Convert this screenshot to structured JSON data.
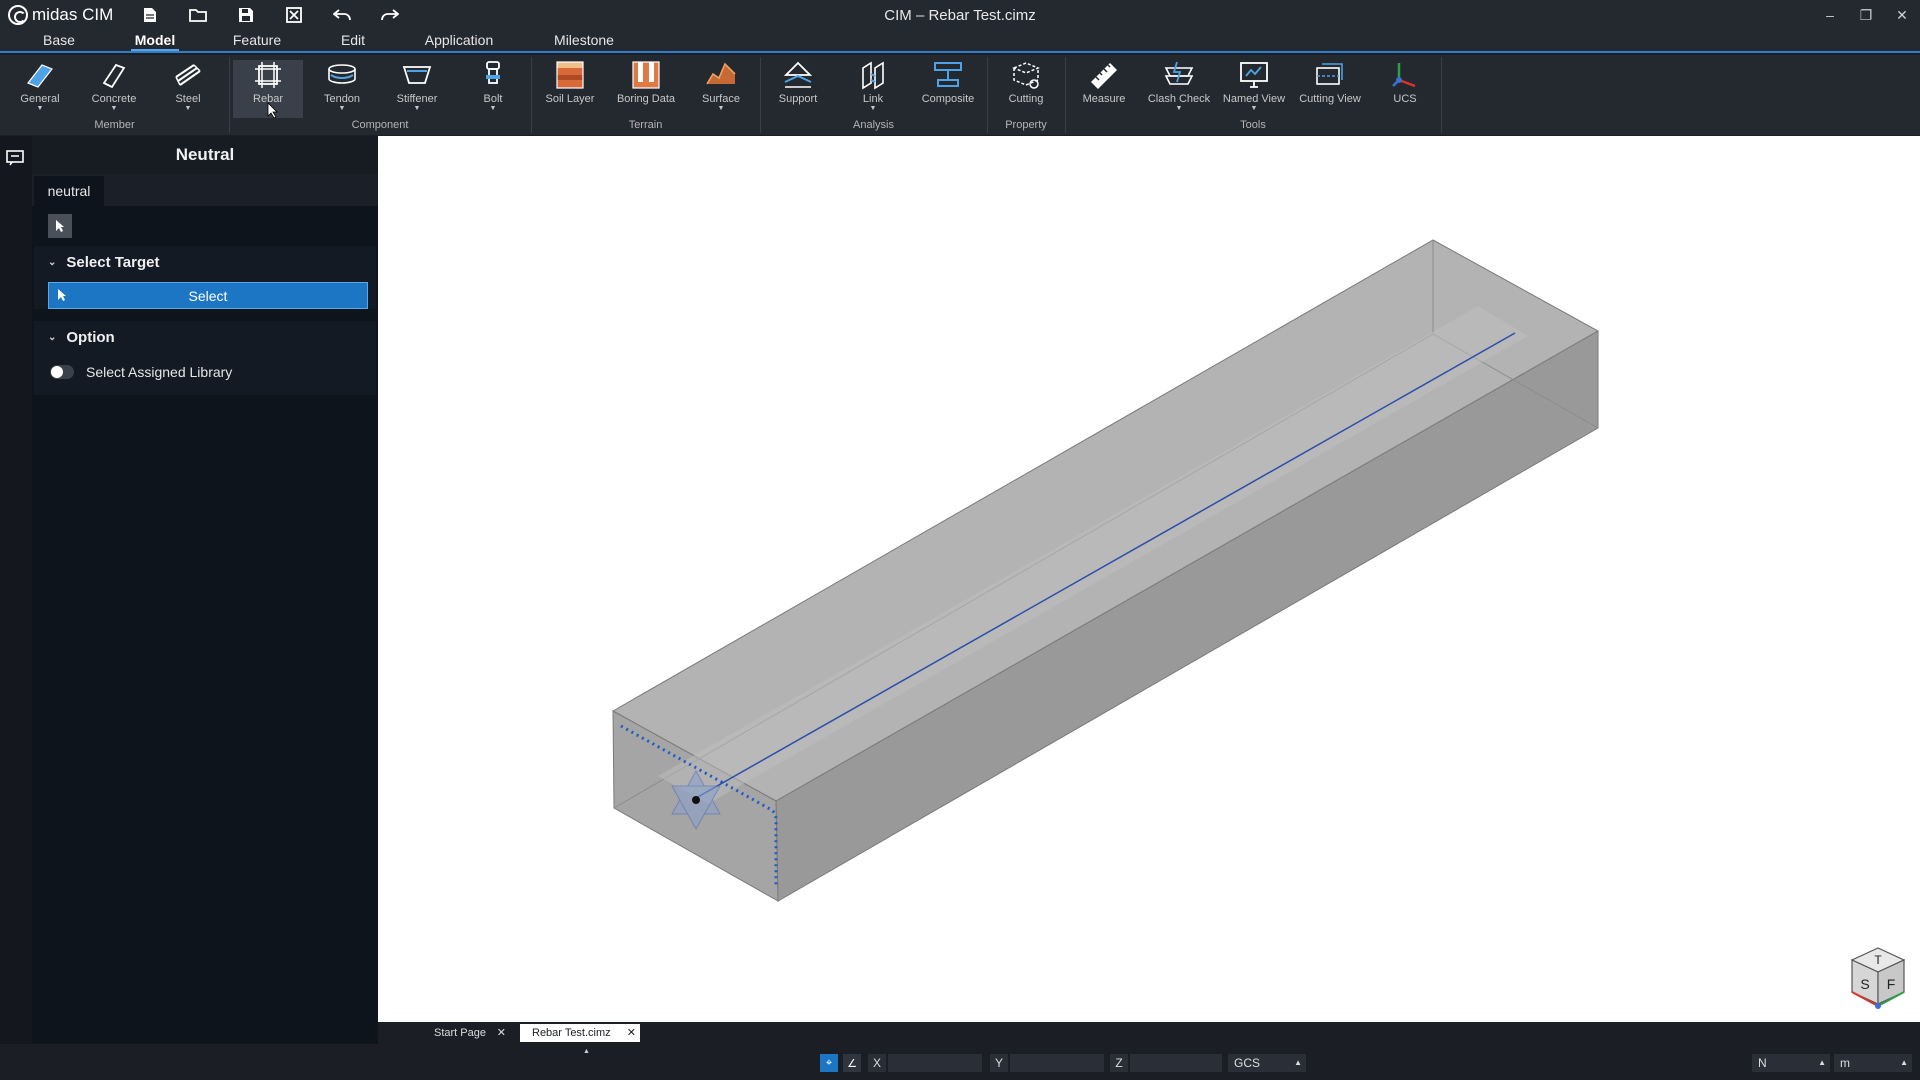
{
  "app": {
    "logo_text": "midas CIM",
    "window_title": "CIM – Rebar Test.cimz"
  },
  "quick_access": [
    "new-file-icon",
    "open-folder-icon",
    "save-icon",
    "close-file-icon",
    "undo-icon",
    "redo-icon"
  ],
  "window_controls": {
    "minimize": "–",
    "restore": "❐",
    "close": "✕"
  },
  "menu": {
    "tabs": [
      {
        "label": "Base"
      },
      {
        "label": "Model",
        "active": true
      },
      {
        "label": "Feature"
      },
      {
        "label": "Edit"
      },
      {
        "label": "Application"
      },
      {
        "label": "Milestone"
      }
    ]
  },
  "ribbon": {
    "buttons": [
      {
        "label": "General",
        "icon": "general-icon",
        "dropdown": true
      },
      {
        "label": "Concrete",
        "icon": "concrete-icon",
        "dropdown": true
      },
      {
        "label": "Steel",
        "icon": "steel-icon",
        "dropdown": true
      },
      {
        "label": "Rebar",
        "icon": "rebar-icon",
        "dropdown": false,
        "hover": true
      },
      {
        "label": "Tendon",
        "icon": "tendon-icon",
        "dropdown": true
      },
      {
        "label": "Stiffener",
        "icon": "stiffener-icon",
        "dropdown": true
      },
      {
        "label": "Bolt",
        "icon": "bolt-icon",
        "dropdown": true
      },
      {
        "label": "Soil Layer",
        "icon": "soil-layer-icon",
        "dropdown": false
      },
      {
        "label": "Boring Data",
        "icon": "boring-data-icon",
        "dropdown": false
      },
      {
        "label": "Surface",
        "icon": "surface-icon",
        "dropdown": true
      },
      {
        "label": "Support",
        "icon": "support-icon",
        "dropdown": false
      },
      {
        "label": "Link",
        "icon": "link-icon",
        "dropdown": true
      },
      {
        "label": "Composite",
        "icon": "composite-icon",
        "dropdown": false
      },
      {
        "label": "Cutting",
        "icon": "cutting-icon",
        "dropdown": false
      },
      {
        "label": "Measure",
        "icon": "measure-icon",
        "dropdown": false
      },
      {
        "label": "Clash Check",
        "icon": "clash-check-icon",
        "dropdown": true
      },
      {
        "label": "Named View",
        "icon": "named-view-icon",
        "dropdown": true
      },
      {
        "label": "Cutting View",
        "icon": "cutting-view-icon",
        "dropdown": false
      },
      {
        "label": "UCS",
        "icon": "ucs-icon",
        "dropdown": false
      }
    ],
    "groups": [
      {
        "label": "Member"
      },
      {
        "label": "Component"
      },
      {
        "label": "Terrain"
      },
      {
        "label": "Analysis"
      },
      {
        "label": "Property"
      },
      {
        "label": "Tools"
      }
    ]
  },
  "panel": {
    "title": "Neutral",
    "tab": "neutral",
    "sections": {
      "select_target": {
        "title": "Select Target",
        "button": "Select"
      },
      "option": {
        "title": "Option",
        "toggle_label": "Select Assigned Library",
        "toggle_on": false
      }
    }
  },
  "doc_tabs": [
    {
      "label": "Start Page",
      "active": false
    },
    {
      "label": "Rebar Test.cimz",
      "active": true
    }
  ],
  "view_cube": {
    "top": "T",
    "front": "F",
    "side": "S"
  },
  "status": {
    "x_label": "X",
    "y_label": "Y",
    "z_label": "Z",
    "x_value": "",
    "y_value": "",
    "z_value": "",
    "coord_system": "GCS",
    "force_unit": "N",
    "length_unit": "m"
  },
  "colors": {
    "accent": "#1d76c4",
    "viewport_bg": "#ffffff",
    "solid_fill": "#a9a9a9",
    "rebar_line": "#2b4fa8"
  }
}
